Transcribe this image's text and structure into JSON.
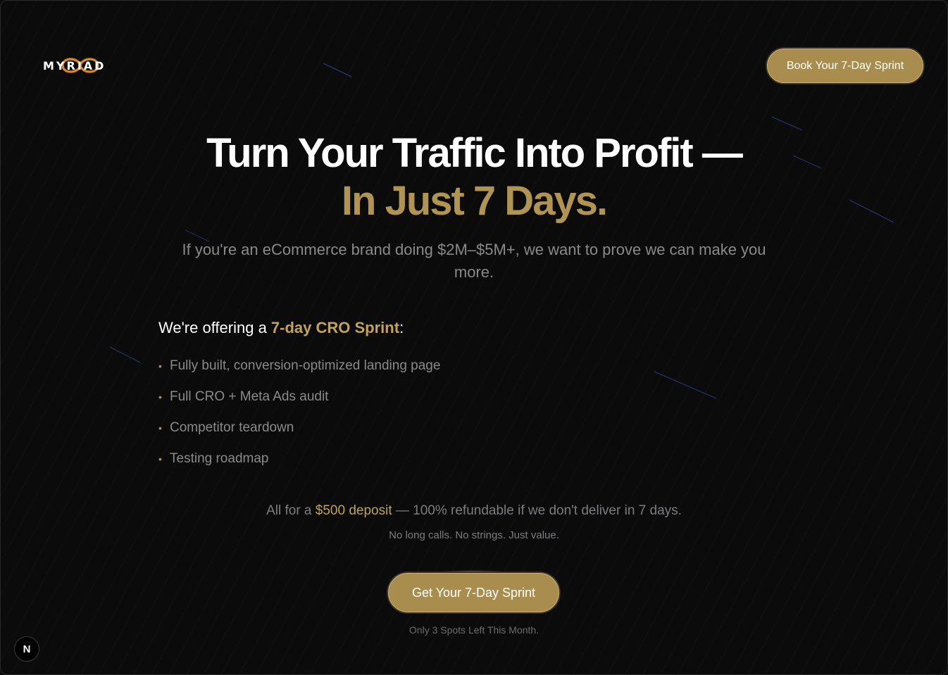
{
  "brand": {
    "logo_text": "MYRIAD",
    "accent_color": "#b09454",
    "logo_ring_color": "#c8761f"
  },
  "nav": {
    "cta_label": "Book Your 7-Day Sprint"
  },
  "hero": {
    "headline_line1": "Turn Your Traffic Into Profit —",
    "headline_line2": "In Just 7 Days.",
    "subtitle": "If you're an eCommerce brand doing $2M–$5M+, we want to prove we can make you more."
  },
  "offer": {
    "heading_prefix": "We're offering a ",
    "heading_highlight": "7-day CRO Sprint",
    "heading_suffix": ":",
    "items": [
      {
        "label": "Fully built, conversion-optimized landing page"
      },
      {
        "label": "Full CRO + Meta Ads audit"
      },
      {
        "label": "Competitor teardown"
      },
      {
        "label": "Testing roadmap"
      }
    ]
  },
  "pricing": {
    "prefix": "All for a ",
    "highlight": "$500 deposit",
    "suffix": " — 100% refundable if we don't deliver in 7 days.",
    "tagline": "No long calls. No strings. Just value."
  },
  "cta": {
    "label": "Get Your 7-Day Sprint",
    "scarcity": "Only 3 Spots Left This Month."
  },
  "dev_badge": {
    "letter": "N"
  }
}
